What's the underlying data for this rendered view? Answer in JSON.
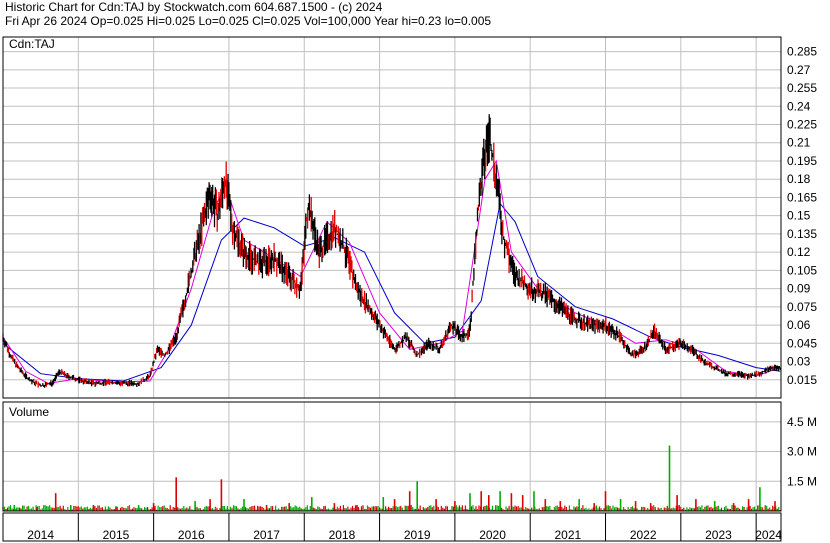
{
  "header": {
    "line1": "Historic Chart for Cdn:TAJ by Stockwatch.com 604.687.1500 - (c) 2024",
    "line2": "Fri Apr 26 2024   Op=0.025  Hi=0.025  Lo=0.025  Cl=0.025  Vol=100,000  Year hi=0.23  lo=0.005"
  },
  "colors": {
    "price_bars": "#000000",
    "down_ticks": "#e00000",
    "ma_short": "#e000e0",
    "ma_long": "#0000cc",
    "grid": "#c0c0c0",
    "vol_up": "#00aa00",
    "vol_down": "#dd0000"
  },
  "chart_data": [
    {
      "type": "line",
      "title": "Cdn:TAJ",
      "y_ticks": [
        "0.285",
        "0.27",
        "0.255",
        "0.24",
        "0.225",
        "0.21",
        "0.195",
        "0.18",
        "0.165",
        "0.15",
        "0.135",
        "0.12",
        "0.105",
        "0.09",
        "0.075",
        "0.06",
        "0.045",
        "0.03",
        "0.015"
      ],
      "ylim": [
        0.0,
        0.297
      ],
      "x_ticks": [
        "2014",
        "2015",
        "2016",
        "2017",
        "2018",
        "2019",
        "2020",
        "2021",
        "2022",
        "2023",
        "2024"
      ],
      "xlim": [
        2014.0,
        2024.33
      ],
      "grid": true,
      "price_points": [
        {
          "x": 2014.0,
          "y": 0.05
        },
        {
          "x": 2014.1,
          "y": 0.035
        },
        {
          "x": 2014.2,
          "y": 0.025
        },
        {
          "x": 2014.35,
          "y": 0.015
        },
        {
          "x": 2014.5,
          "y": 0.01
        },
        {
          "x": 2014.65,
          "y": 0.012
        },
        {
          "x": 2014.75,
          "y": 0.022
        },
        {
          "x": 2014.85,
          "y": 0.018
        },
        {
          "x": 2015.0,
          "y": 0.015
        },
        {
          "x": 2015.2,
          "y": 0.012
        },
        {
          "x": 2015.4,
          "y": 0.013
        },
        {
          "x": 2015.6,
          "y": 0.012
        },
        {
          "x": 2015.8,
          "y": 0.012
        },
        {
          "x": 2015.95,
          "y": 0.018
        },
        {
          "x": 2016.05,
          "y": 0.04
        },
        {
          "x": 2016.15,
          "y": 0.035
        },
        {
          "x": 2016.3,
          "y": 0.05
        },
        {
          "x": 2016.45,
          "y": 0.09
        },
        {
          "x": 2016.6,
          "y": 0.13
        },
        {
          "x": 2016.75,
          "y": 0.17
        },
        {
          "x": 2016.85,
          "y": 0.15
        },
        {
          "x": 2016.95,
          "y": 0.18
        },
        {
          "x": 2017.05,
          "y": 0.14
        },
        {
          "x": 2017.2,
          "y": 0.12
        },
        {
          "x": 2017.4,
          "y": 0.11
        },
        {
          "x": 2017.6,
          "y": 0.115
        },
        {
          "x": 2017.8,
          "y": 0.1
        },
        {
          "x": 2017.95,
          "y": 0.09
        },
        {
          "x": 2018.05,
          "y": 0.16
        },
        {
          "x": 2018.2,
          "y": 0.12
        },
        {
          "x": 2018.4,
          "y": 0.14
        },
        {
          "x": 2018.55,
          "y": 0.12
        },
        {
          "x": 2018.7,
          "y": 0.09
        },
        {
          "x": 2018.85,
          "y": 0.075
        },
        {
          "x": 2019.05,
          "y": 0.055
        },
        {
          "x": 2019.2,
          "y": 0.04
        },
        {
          "x": 2019.35,
          "y": 0.05
        },
        {
          "x": 2019.5,
          "y": 0.035
        },
        {
          "x": 2019.65,
          "y": 0.045
        },
        {
          "x": 2019.8,
          "y": 0.04
        },
        {
          "x": 2019.95,
          "y": 0.06
        },
        {
          "x": 2020.1,
          "y": 0.05
        },
        {
          "x": 2020.2,
          "y": 0.055
        },
        {
          "x": 2020.3,
          "y": 0.15
        },
        {
          "x": 2020.4,
          "y": 0.2
        },
        {
          "x": 2020.45,
          "y": 0.22
        },
        {
          "x": 2020.55,
          "y": 0.18
        },
        {
          "x": 2020.65,
          "y": 0.13
        },
        {
          "x": 2020.8,
          "y": 0.1
        },
        {
          "x": 2021.0,
          "y": 0.09
        },
        {
          "x": 2021.2,
          "y": 0.085
        },
        {
          "x": 2021.4,
          "y": 0.075
        },
        {
          "x": 2021.6,
          "y": 0.065
        },
        {
          "x": 2021.8,
          "y": 0.06
        },
        {
          "x": 2022.0,
          "y": 0.06
        },
        {
          "x": 2022.2,
          "y": 0.05
        },
        {
          "x": 2022.35,
          "y": 0.035
        },
        {
          "x": 2022.5,
          "y": 0.04
        },
        {
          "x": 2022.65,
          "y": 0.055
        },
        {
          "x": 2022.8,
          "y": 0.04
        },
        {
          "x": 2023.0,
          "y": 0.045
        },
        {
          "x": 2023.15,
          "y": 0.04
        },
        {
          "x": 2023.3,
          "y": 0.03
        },
        {
          "x": 2023.45,
          "y": 0.025
        },
        {
          "x": 2023.6,
          "y": 0.02
        },
        {
          "x": 2023.75,
          "y": 0.02
        },
        {
          "x": 2023.9,
          "y": 0.018
        },
        {
          "x": 2024.05,
          "y": 0.02
        },
        {
          "x": 2024.2,
          "y": 0.025
        },
        {
          "x": 2024.32,
          "y": 0.025
        }
      ],
      "ma_short": [
        {
          "x": 2014.0,
          "y": 0.05
        },
        {
          "x": 2014.3,
          "y": 0.022
        },
        {
          "x": 2014.6,
          "y": 0.012
        },
        {
          "x": 2015.0,
          "y": 0.016
        },
        {
          "x": 2015.5,
          "y": 0.013
        },
        {
          "x": 2015.95,
          "y": 0.014
        },
        {
          "x": 2016.2,
          "y": 0.04
        },
        {
          "x": 2016.5,
          "y": 0.09
        },
        {
          "x": 2016.8,
          "y": 0.155
        },
        {
          "x": 2016.95,
          "y": 0.175
        },
        {
          "x": 2017.2,
          "y": 0.13
        },
        {
          "x": 2017.6,
          "y": 0.115
        },
        {
          "x": 2017.95,
          "y": 0.1
        },
        {
          "x": 2018.3,
          "y": 0.145
        },
        {
          "x": 2018.6,
          "y": 0.128
        },
        {
          "x": 2019.0,
          "y": 0.07
        },
        {
          "x": 2019.4,
          "y": 0.04
        },
        {
          "x": 2019.8,
          "y": 0.045
        },
        {
          "x": 2020.1,
          "y": 0.055
        },
        {
          "x": 2020.4,
          "y": 0.18
        },
        {
          "x": 2020.55,
          "y": 0.195
        },
        {
          "x": 2020.75,
          "y": 0.12
        },
        {
          "x": 2021.1,
          "y": 0.09
        },
        {
          "x": 2021.6,
          "y": 0.07
        },
        {
          "x": 2022.0,
          "y": 0.06
        },
        {
          "x": 2022.4,
          "y": 0.045
        },
        {
          "x": 2022.8,
          "y": 0.048
        },
        {
          "x": 2023.2,
          "y": 0.04
        },
        {
          "x": 2023.6,
          "y": 0.022
        },
        {
          "x": 2024.0,
          "y": 0.018
        },
        {
          "x": 2024.32,
          "y": 0.025
        }
      ],
      "ma_long": [
        {
          "x": 2014.0,
          "y": 0.045
        },
        {
          "x": 2014.5,
          "y": 0.02
        },
        {
          "x": 2015.0,
          "y": 0.016
        },
        {
          "x": 2015.6,
          "y": 0.014
        },
        {
          "x": 2016.1,
          "y": 0.025
        },
        {
          "x": 2016.5,
          "y": 0.06
        },
        {
          "x": 2016.9,
          "y": 0.13
        },
        {
          "x": 2017.2,
          "y": 0.148
        },
        {
          "x": 2017.6,
          "y": 0.14
        },
        {
          "x": 2018.0,
          "y": 0.125
        },
        {
          "x": 2018.4,
          "y": 0.132
        },
        {
          "x": 2018.8,
          "y": 0.12
        },
        {
          "x": 2019.2,
          "y": 0.07
        },
        {
          "x": 2019.6,
          "y": 0.045
        },
        {
          "x": 2020.0,
          "y": 0.05
        },
        {
          "x": 2020.35,
          "y": 0.08
        },
        {
          "x": 2020.6,
          "y": 0.16
        },
        {
          "x": 2020.8,
          "y": 0.145
        },
        {
          "x": 2021.1,
          "y": 0.1
        },
        {
          "x": 2021.6,
          "y": 0.075
        },
        {
          "x": 2022.1,
          "y": 0.065
        },
        {
          "x": 2022.6,
          "y": 0.05
        },
        {
          "x": 2023.0,
          "y": 0.042
        },
        {
          "x": 2023.5,
          "y": 0.035
        },
        {
          "x": 2024.0,
          "y": 0.025
        },
        {
          "x": 2024.32,
          "y": 0.022
        }
      ]
    },
    {
      "type": "bar",
      "title": "Volume",
      "y_ticks": [
        "4.5 M",
        "3.0 M",
        "1.5 M"
      ],
      "ylim": [
        0,
        5.5
      ],
      "unit": "M",
      "grid": true,
      "bars": [
        {
          "x": 2014.15,
          "v": 0.3
        },
        {
          "x": 2014.45,
          "v": 0.2
        },
        {
          "x": 2014.7,
          "v": 0.9
        },
        {
          "x": 2014.9,
          "v": 0.3
        },
        {
          "x": 2015.2,
          "v": 0.3
        },
        {
          "x": 2015.5,
          "v": 0.2
        },
        {
          "x": 2015.8,
          "v": 0.3
        },
        {
          "x": 2016.0,
          "v": 0.4
        },
        {
          "x": 2016.3,
          "v": 1.7
        },
        {
          "x": 2016.55,
          "v": 0.5
        },
        {
          "x": 2016.75,
          "v": 0.6
        },
        {
          "x": 2016.9,
          "v": 1.6
        },
        {
          "x": 2017.2,
          "v": 0.6
        },
        {
          "x": 2017.5,
          "v": 0.3
        },
        {
          "x": 2017.8,
          "v": 0.4
        },
        {
          "x": 2018.1,
          "v": 0.7
        },
        {
          "x": 2018.4,
          "v": 0.4
        },
        {
          "x": 2018.7,
          "v": 0.3
        },
        {
          "x": 2019.05,
          "v": 0.7
        },
        {
          "x": 2019.2,
          "v": 0.6
        },
        {
          "x": 2019.4,
          "v": 1.0
        },
        {
          "x": 2019.5,
          "v": 1.5
        },
        {
          "x": 2019.75,
          "v": 0.6
        },
        {
          "x": 2020.0,
          "v": 0.5
        },
        {
          "x": 2020.2,
          "v": 0.9
        },
        {
          "x": 2020.35,
          "v": 1.0
        },
        {
          "x": 2020.45,
          "v": 0.8
        },
        {
          "x": 2020.6,
          "v": 1.0
        },
        {
          "x": 2020.75,
          "v": 0.9
        },
        {
          "x": 2020.9,
          "v": 0.8
        },
        {
          "x": 2021.05,
          "v": 1.0
        },
        {
          "x": 2021.2,
          "v": 0.6
        },
        {
          "x": 2021.4,
          "v": 0.5
        },
        {
          "x": 2021.65,
          "v": 0.6
        },
        {
          "x": 2021.85,
          "v": 0.4
        },
        {
          "x": 2022.0,
          "v": 1.0
        },
        {
          "x": 2022.2,
          "v": 0.6
        },
        {
          "x": 2022.4,
          "v": 0.5
        },
        {
          "x": 2022.6,
          "v": 0.4
        },
        {
          "x": 2022.85,
          "v": 3.3
        },
        {
          "x": 2022.95,
          "v": 0.8
        },
        {
          "x": 2023.2,
          "v": 0.6
        },
        {
          "x": 2023.45,
          "v": 0.5
        },
        {
          "x": 2023.7,
          "v": 0.4
        },
        {
          "x": 2023.9,
          "v": 0.6
        },
        {
          "x": 2024.05,
          "v": 1.2
        },
        {
          "x": 2024.25,
          "v": 0.5
        }
      ]
    }
  ]
}
